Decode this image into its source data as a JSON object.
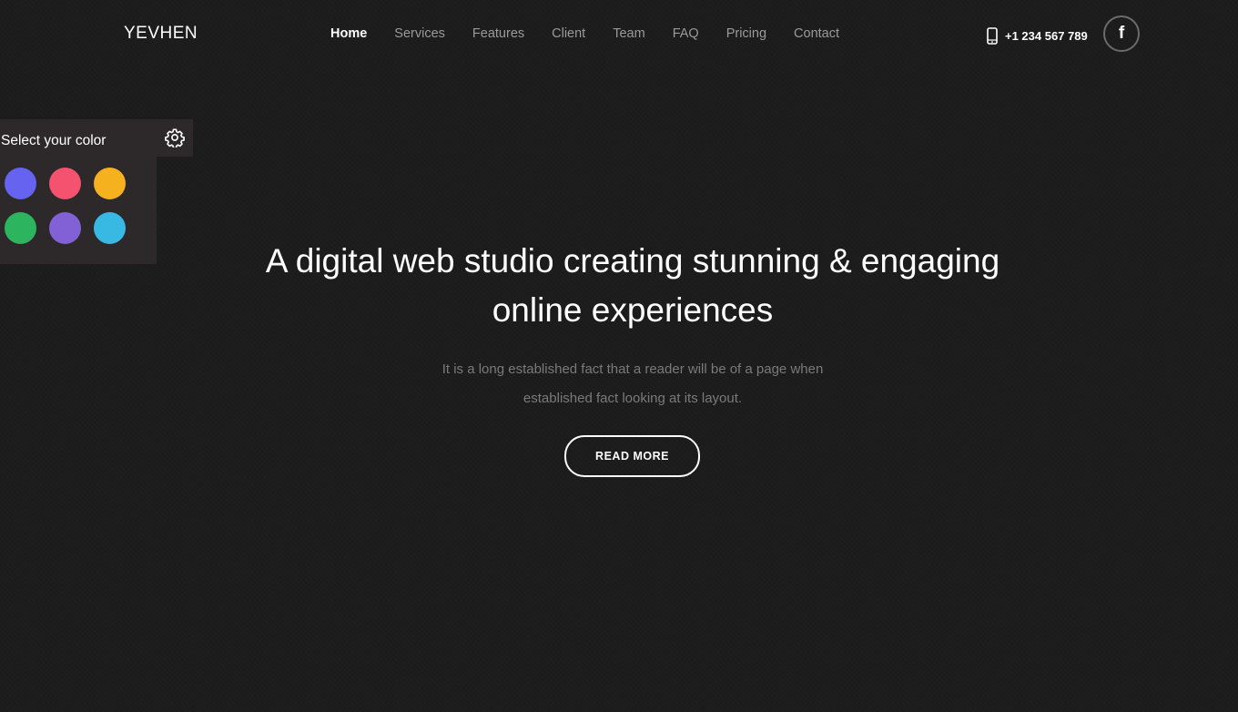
{
  "header": {
    "logo": "YEVHEN",
    "nav": [
      {
        "label": "Home",
        "active": true
      },
      {
        "label": "Services",
        "active": false
      },
      {
        "label": "Features",
        "active": false
      },
      {
        "label": "Client",
        "active": false
      },
      {
        "label": "Team",
        "active": false
      },
      {
        "label": "FAQ",
        "active": false
      },
      {
        "label": "Pricing",
        "active": false
      },
      {
        "label": "Contact",
        "active": false
      }
    ],
    "phone": "+1 234 567 789",
    "phone_icon": "mobile-phone-icon",
    "social_icon": "facebook-icon",
    "social_glyph": "f"
  },
  "color_switcher": {
    "title": "Select your color",
    "gear_icon": "gear-icon",
    "swatches": [
      "#6563f0",
      "#f5526f",
      "#f6b21e",
      "#2cb55e",
      "#8260d6",
      "#37b9e3"
    ]
  },
  "hero": {
    "title_line1": "A digital web studio creating stunning & engaging",
    "title_line2": "online experiences",
    "text_line1": "It is a long established fact that a reader will be of a page when",
    "text_line2": "established fact looking at its layout.",
    "button": "READ MORE"
  },
  "colors": {
    "background": "#1c1c1c",
    "panel": "#2d2829",
    "nav_inactive": "#9a9a9a",
    "body_text": "#7a7a7a"
  }
}
